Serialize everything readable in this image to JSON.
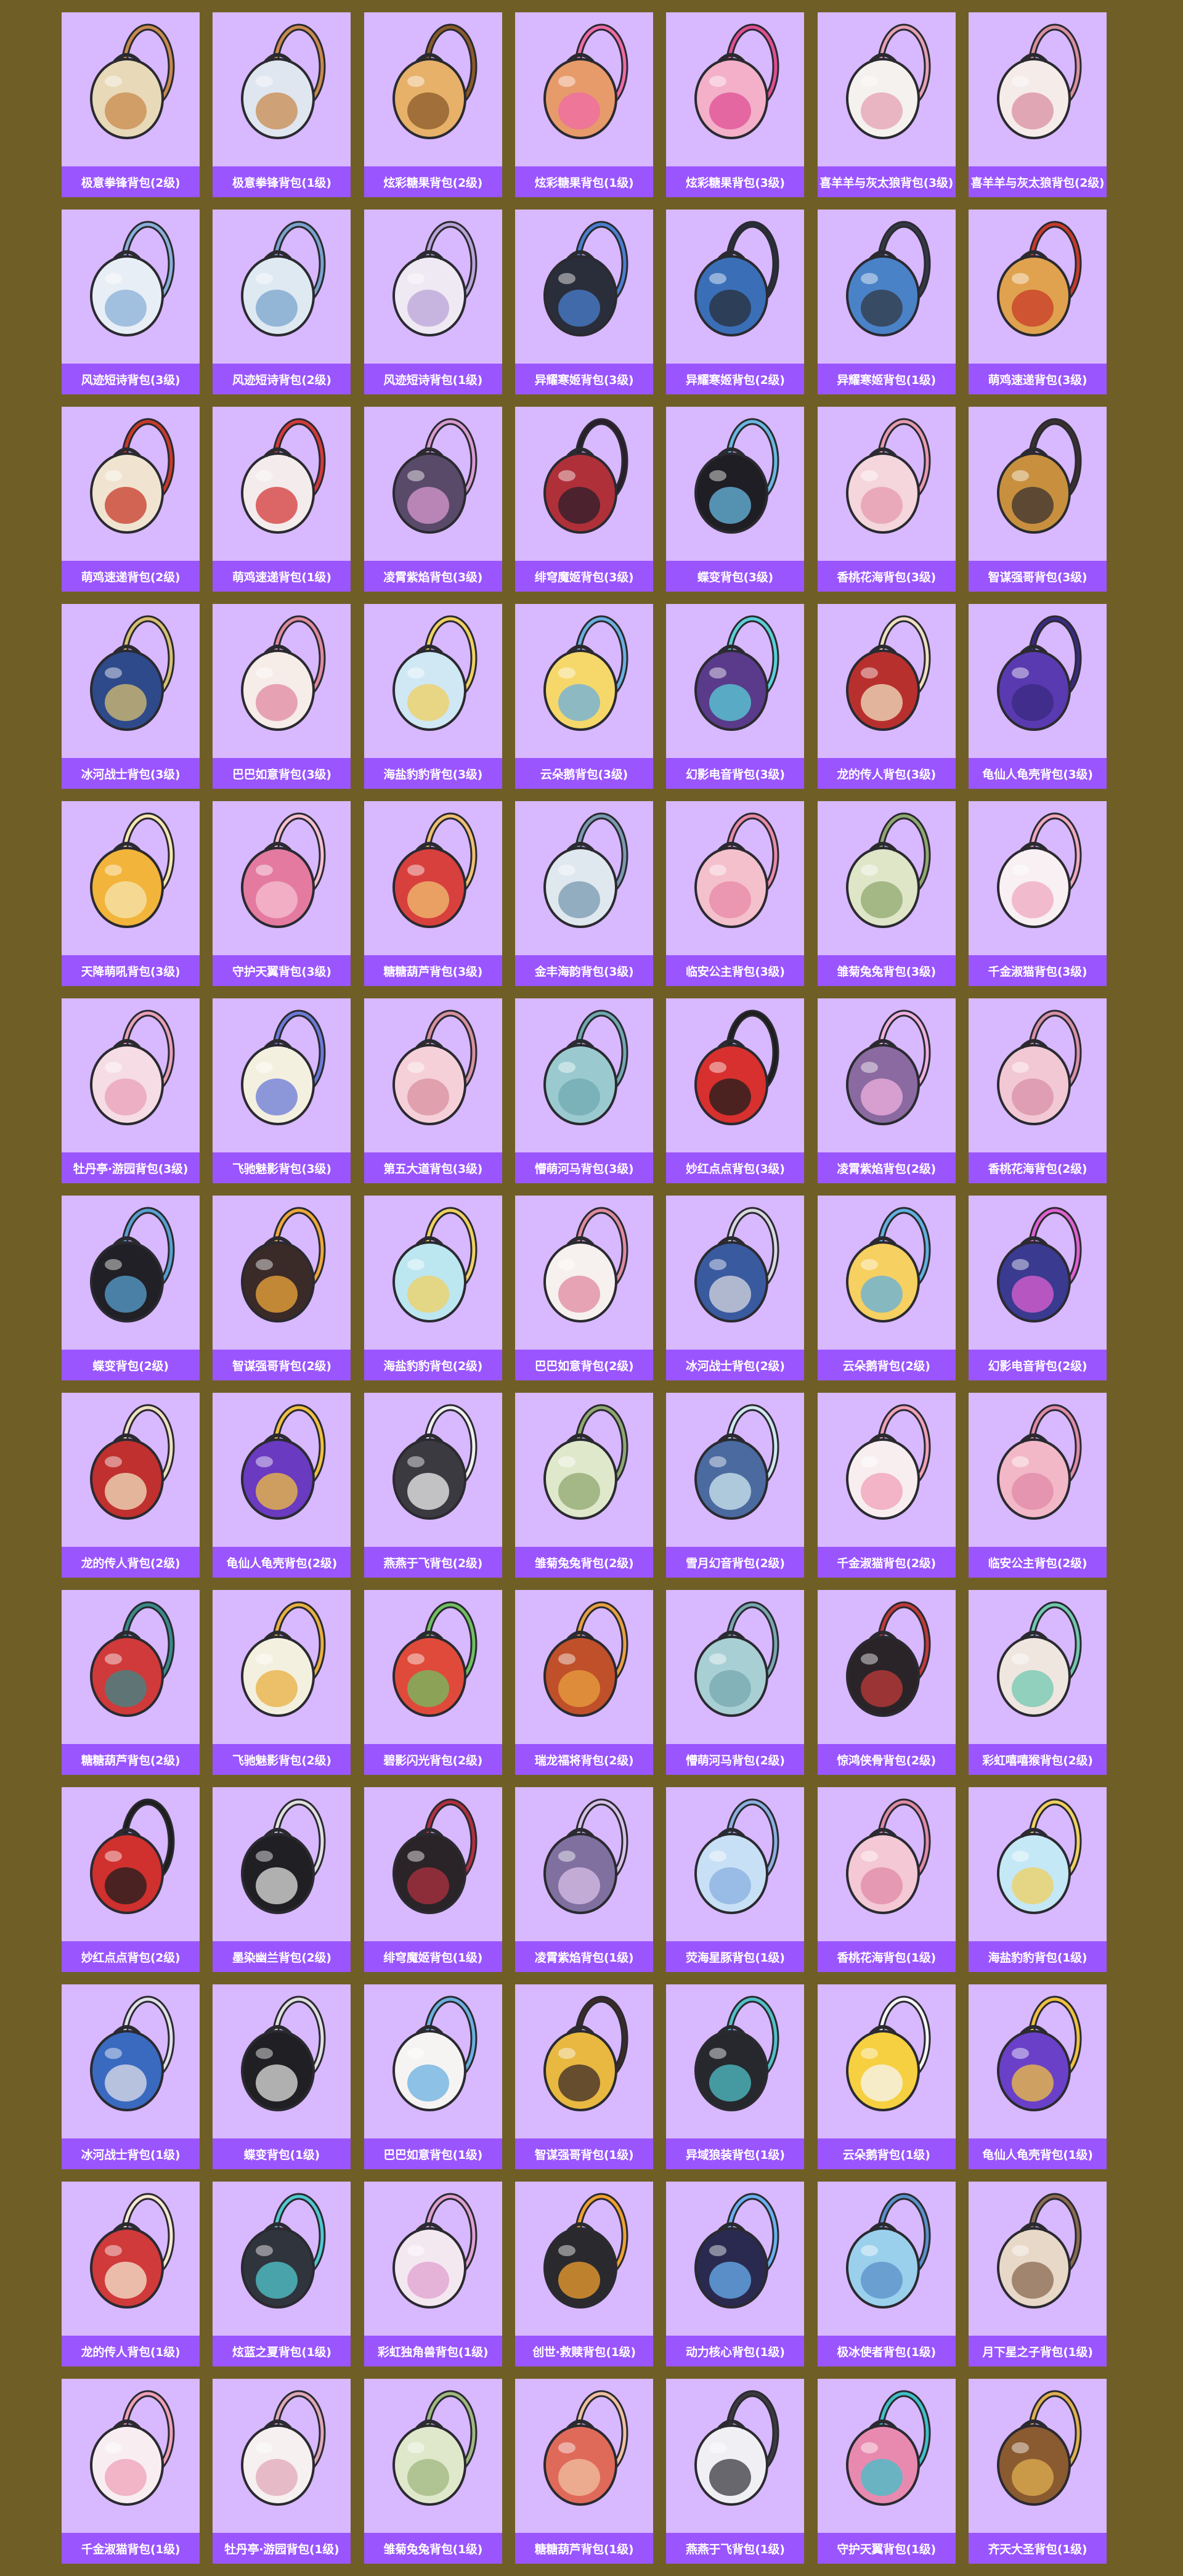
{
  "items": [
    {
      "label": "极意拳锋背包(2级)",
      "icon": "milk-tea-backpack-icon",
      "color": "#e8d9b8",
      "accent": "#c98a4e"
    },
    {
      "label": "极意拳锋背包(1级)",
      "icon": "milk-tea-backpack-icon",
      "color": "#dfe6f0",
      "accent": "#c98a4e"
    },
    {
      "label": "炫彩糖果背包(2级)",
      "icon": "donut-backpack-icon",
      "color": "#e7b16a",
      "accent": "#8a5a2a"
    },
    {
      "label": "炫彩糖果背包(1级)",
      "icon": "donut-backpack-icon",
      "color": "#e79a6a",
      "accent": "#f06aa8"
    },
    {
      "label": "炫彩糖果背包(3级)",
      "icon": "donut-backpack-icon",
      "color": "#f3b0c8",
      "accent": "#e04f94"
    },
    {
      "label": "喜羊羊与灰太狼背包(3级)",
      "icon": "sheep-backpack-icon",
      "color": "#f4f1ee",
      "accent": "#e6a0b4"
    },
    {
      "label": "喜羊羊与灰太狼背包(2级)",
      "icon": "sheep-backpack-icon",
      "color": "#f5ecea",
      "accent": "#d98fa0"
    },
    {
      "label": "风迹短诗背包(3级)",
      "icon": "poem-backpack-icon",
      "color": "#e8eef5",
      "accent": "#8ab0d8"
    },
    {
      "label": "风迹短诗背包(2级)",
      "icon": "poem-backpack-icon",
      "color": "#dfe9f2",
      "accent": "#7aa3cc"
    },
    {
      "label": "风迹短诗背包(1级)",
      "icon": "poem-backpack-icon",
      "color": "#efe9f3",
      "accent": "#b9a3d8"
    },
    {
      "label": "异耀寒姬背包(3级)",
      "icon": "robot-backpack-icon",
      "color": "#2a2e3a",
      "accent": "#4a7fd0"
    },
    {
      "label": "异耀寒姬背包(2级)",
      "icon": "robot-backpack-icon",
      "color": "#3a6fb8",
      "accent": "#2a2e3a"
    },
    {
      "label": "异耀寒姬背包(1级)",
      "icon": "robot-backpack-icon",
      "color": "#4a82c8",
      "accent": "#333844"
    },
    {
      "label": "萌鸡速递背包(3级)",
      "icon": "chick-backpack-icon",
      "color": "#e0a24e",
      "accent": "#c83a2a"
    },
    {
      "label": "萌鸡速递背包(2级)",
      "icon": "chick-backpack-icon",
      "color": "#f0e4d0",
      "accent": "#c83a2a"
    },
    {
      "label": "萌鸡速递背包(1级)",
      "icon": "chick-backpack-icon",
      "color": "#f4ecec",
      "accent": "#d43a3a"
    },
    {
      "label": "凌霄紫焰背包(3级)",
      "icon": "orb-backpack-icon",
      "color": "#5a4a6a",
      "accent": "#d89ad0"
    },
    {
      "label": "绯穹魔姬背包(3级)",
      "icon": "bat-backpack-icon",
      "color": "#b0303a",
      "accent": "#2a1e2a"
    },
    {
      "label": "蝶变背包(3级)",
      "icon": "butterfly-backpack-icon",
      "color": "#1e1e24",
      "accent": "#68b8e0"
    },
    {
      "label": "香桃花海背包(3级)",
      "icon": "flower-backpack-icon",
      "color": "#f4d6dc",
      "accent": "#e79ab0"
    },
    {
      "label": "智谋强哥背包(3级)",
      "icon": "bear-backpack-icon",
      "color": "#c8903e",
      "accent": "#3a3030"
    },
    {
      "label": "冰河战士背包(3级)",
      "icon": "school-backpack-icon",
      "color": "#2e4a8a",
      "accent": "#d8c070"
    },
    {
      "label": "巴巴如意背包(3级)",
      "icon": "fox-backpack-icon",
      "color": "#f6ece8",
      "accent": "#e08aa0"
    },
    {
      "label": "海盐豹豹背包(3级)",
      "icon": "seal-backpack-icon",
      "color": "#cfe8f4",
      "accent": "#f0d060"
    },
    {
      "label": "云朵鹅背包(3级)",
      "icon": "cloud-backpack-icon",
      "color": "#f6d86a",
      "accent": "#6ab0e0"
    },
    {
      "label": "幻影电音背包(3级)",
      "icon": "speaker-backpack-icon",
      "color": "#5a3a8a",
      "accent": "#5ad0d8"
    },
    {
      "label": "龙的传人背包(3级)",
      "icon": "school-backpack-icon",
      "color": "#b8302e",
      "accent": "#f0e0c0"
    },
    {
      "label": "龟仙人龟壳背包(3级)",
      "icon": "shell-backpack-icon",
      "color": "#5a3ab0",
      "accent": "#3a2a80"
    },
    {
      "label": "天降萌吼背包(3级)",
      "icon": "school-backpack-icon",
      "color": "#f2b43a",
      "accent": "#f6e6b0"
    },
    {
      "label": "守护天翼背包(3级)",
      "icon": "bird-backpack-icon",
      "color": "#e47aa0",
      "accent": "#f6c0d0"
    },
    {
      "label": "糖糖葫芦背包(3级)",
      "icon": "lantern-backpack-icon",
      "color": "#d8403e",
      "accent": "#f0c070"
    },
    {
      "label": "金丰海韵背包(3级)",
      "icon": "shell-ornament-backpack-icon",
      "color": "#dfe8ee",
      "accent": "#7a9ab0"
    },
    {
      "label": "临安公主背包(3级)",
      "icon": "flower-backpack-icon",
      "color": "#f4c0cc",
      "accent": "#e88aa8"
    },
    {
      "label": "雏菊兔兔背包(3级)",
      "icon": "bunny-backpack-icon",
      "color": "#dfe6c8",
      "accent": "#90a870"
    },
    {
      "label": "千金淑猫背包(3级)",
      "icon": "cat-backpack-icon",
      "color": "#f8f0f2",
      "accent": "#f0a8c0"
    },
    {
      "label": "牡丹亭·游园背包(3级)",
      "icon": "bag-backpack-icon",
      "color": "#f6dce4",
      "accent": "#e8a0b8"
    },
    {
      "label": "飞驰魅影背包(3级)",
      "icon": "wing-backpack-icon",
      "color": "#f4f0e0",
      "accent": "#6a7ad8"
    },
    {
      "label": "第五大道背包(3级)",
      "icon": "quilted-bag-icon",
      "color": "#f6d0d8",
      "accent": "#d890a0"
    },
    {
      "label": "懵萌河马背包(3级)",
      "icon": "hippo-backpack-icon",
      "color": "#9acad0",
      "accent": "#70a8b0"
    },
    {
      "label": "妙红点点背包(3级)",
      "icon": "ladybug-backpack-icon",
      "color": "#d8302e",
      "accent": "#1e1e1e"
    },
    {
      "label": "凌霄紫焰背包(2级)",
      "icon": "orb-backpack-icon",
      "color": "#8a6aa0",
      "accent": "#f0b0e0"
    },
    {
      "label": "香桃花海背包(2级)",
      "icon": "flower-backpack-icon",
      "color": "#f2c8d4",
      "accent": "#d890a8"
    },
    {
      "label": "蝶变背包(2级)",
      "icon": "butterfly-backpack-icon",
      "color": "#202026",
      "accent": "#58a0d0"
    },
    {
      "label": "智谋强哥背包(2级)",
      "icon": "bear-backpack-icon",
      "color": "#3a2a28",
      "accent": "#f0a83a"
    },
    {
      "label": "海盐豹豹背包(2级)",
      "icon": "seal-backpack-icon",
      "color": "#bce6f0",
      "accent": "#f0d060"
    },
    {
      "label": "巴巴如意背包(2级)",
      "icon": "fox-backpack-icon",
      "color": "#f6f0ee",
      "accent": "#e08aa0"
    },
    {
      "label": "冰河战士背包(2级)",
      "icon": "school-backpack-icon",
      "color": "#3a5aa0",
      "accent": "#d8d8e0"
    },
    {
      "label": "云朵鹅背包(2级)",
      "icon": "cloud-backpack-icon",
      "color": "#f6d060",
      "accent": "#60b0e0"
    },
    {
      "label": "幻影电音背包(2级)",
      "icon": "speaker-backpack-icon",
      "color": "#3a3a90",
      "accent": "#e060d0"
    },
    {
      "label": "龙的传人背包(2级)",
      "icon": "school-backpack-icon",
      "color": "#c0302e",
      "accent": "#f0e0c0"
    },
    {
      "label": "龟仙人龟壳背包(2级)",
      "icon": "shell-backpack-icon",
      "color": "#6a3ac0",
      "accent": "#f0c040"
    },
    {
      "label": "燕燕于飞背包(2级)",
      "icon": "swallow-backpack-icon",
      "color": "#3a3a40",
      "accent": "#f0f0f0"
    },
    {
      "label": "雏菊兔兔背包(2级)",
      "icon": "bunny-backpack-icon",
      "color": "#e0e8cc",
      "accent": "#90a870"
    },
    {
      "label": "雪月幻音背包(2级)",
      "icon": "speaker-backpack-icon",
      "color": "#4a6aa0",
      "accent": "#d0e8f0"
    },
    {
      "label": "千金淑猫背包(2级)",
      "icon": "cat-backpack-icon",
      "color": "#f8eef0",
      "accent": "#f0a0b8"
    },
    {
      "label": "临安公主背包(2级)",
      "icon": "flower-backpack-icon",
      "color": "#f2b8c8",
      "accent": "#e08aa8"
    },
    {
      "label": "糖糖葫芦背包(2级)",
      "icon": "lantern-backpack-icon",
      "color": "#d03a3a",
      "accent": "#3a8a8a"
    },
    {
      "label": "飞驰魅影背包(2级)",
      "icon": "wing-backpack-icon",
      "color": "#f4f0e0",
      "accent": "#e8b040"
    },
    {
      "label": "碧影闪光背包(2级)",
      "icon": "gamepad-backpack-icon",
      "color": "#e04a3a",
      "accent": "#70c060"
    },
    {
      "label": "瑞龙福将背包(2级)",
      "icon": "dragon-backpack-icon",
      "color": "#c0502a",
      "accent": "#e8a040"
    },
    {
      "label": "懵萌河马背包(2级)",
      "icon": "hippo-backpack-icon",
      "color": "#a8d0d4",
      "accent": "#78a8b0"
    },
    {
      "label": "惊鸿侠骨背包(2级)",
      "icon": "armor-backpack-icon",
      "color": "#2a2428",
      "accent": "#c03a3a"
    },
    {
      "label": "彩虹嘻嘻猴背包(2级)",
      "icon": "rainbow-backpack-icon",
      "color": "#f0e6e0",
      "accent": "#70c8b0"
    },
    {
      "label": "妙红点点背包(2级)",
      "icon": "ladybug-backpack-icon",
      "color": "#d0302e",
      "accent": "#1e1e1e"
    },
    {
      "label": "墨染幽兰背包(2级)",
      "icon": "drum-backpack-icon",
      "color": "#202024",
      "accent": "#e0e0e0"
    },
    {
      "label": "绯穹魔姬背包(1级)",
      "icon": "bat-backpack-icon",
      "color": "#2a2428",
      "accent": "#b03040"
    },
    {
      "label": "凌霄紫焰背包(1级)",
      "icon": "orb-backpack-icon",
      "color": "#8070a0",
      "accent": "#d8c0e8"
    },
    {
      "label": "荧海星豚背包(1级)",
      "icon": "dolphin-backpack-icon",
      "color": "#c8e0f6",
      "accent": "#8ab0e0"
    },
    {
      "label": "香桃花海背包(1级)",
      "icon": "flower-backpack-icon",
      "color": "#f4c8d4",
      "accent": "#e08aa8"
    },
    {
      "label": "海盐豹豹背包(1级)",
      "icon": "seal-backpack-icon",
      "color": "#c4e8f6",
      "accent": "#f0d060"
    },
    {
      "label": "冰河战士背包(1级)",
      "icon": "school-backpack-icon",
      "color": "#3a6ac0",
      "accent": "#e0e0e8"
    },
    {
      "label": "蝶变背包(1级)",
      "icon": "butterfly-backpack-icon",
      "color": "#202024",
      "accent": "#e0e0e0"
    },
    {
      "label": "巴巴如意背包(1级)",
      "icon": "egg-backpack-icon",
      "color": "#f6f4f2",
      "accent": "#6ab0e0"
    },
    {
      "label": "智谋强哥背包(1级)",
      "icon": "bear-backpack-icon",
      "color": "#e8b840",
      "accent": "#3a2a28"
    },
    {
      "label": "异域狼装背包(1级)",
      "icon": "tech-backpack-icon",
      "color": "#26282e",
      "accent": "#50c0c8"
    },
    {
      "label": "云朵鹅背包(1级)",
      "icon": "cloud-backpack-icon",
      "color": "#f6d040",
      "accent": "#f6f6f6"
    },
    {
      "label": "龟仙人龟壳背包(1级)",
      "icon": "shell-backpack-icon",
      "color": "#6a40c8",
      "accent": "#f0c040"
    },
    {
      "label": "龙的传人背包(1级)",
      "icon": "school-backpack-icon",
      "color": "#d03a3a",
      "accent": "#f6e8d0"
    },
    {
      "label": "炫蓝之夏背包(1级)",
      "icon": "tech-backpack-icon",
      "color": "#30343c",
      "accent": "#50c8d0"
    },
    {
      "label": "彩虹独角兽背包(1级)",
      "icon": "unicorn-backpack-icon",
      "color": "#f4e8f0",
      "accent": "#e0a0d0"
    },
    {
      "label": "创世·救赎背包(1级)",
      "icon": "armor-backpack-icon",
      "color": "#2a2a2e",
      "accent": "#f0a030"
    },
    {
      "label": "动力核心背包(1级)",
      "icon": "tech-backpack-icon",
      "color": "#2a2a50",
      "accent": "#6ab0f0"
    },
    {
      "label": "极冰使者背包(1级)",
      "icon": "crystal-backpack-icon",
      "color": "#9ad0ec",
      "accent": "#5a90c8"
    },
    {
      "label": "月下星之子背包(1级)",
      "icon": "orb-backpack-icon",
      "color": "#e8d8c8",
      "accent": "#8a6a50"
    },
    {
      "label": "千金淑猫背包(1级)",
      "icon": "cat-backpack-icon",
      "color": "#f8eef2",
      "accent": "#f0a0b8"
    },
    {
      "label": "牡丹亭·游园背包(1级)",
      "icon": "bag-backpack-icon",
      "color": "#f6f0f0",
      "accent": "#e0a8b8"
    },
    {
      "label": "雏菊兔兔背包(1级)",
      "icon": "bunny-backpack-icon",
      "color": "#e0e8cc",
      "accent": "#a0b880"
    },
    {
      "label": "糖糖葫芦背包(1级)",
      "icon": "lantern-backpack-icon",
      "color": "#e06a5a",
      "accent": "#f0c0a0"
    },
    {
      "label": "燕燕于飞背包(1级)",
      "icon": "swallow-backpack-icon",
      "color": "#f0f0f4",
      "accent": "#3a3a40"
    },
    {
      "label": "守护天翼背包(1级)",
      "icon": "bird-backpack-icon",
      "color": "#e88ab0",
      "accent": "#40c0c8"
    },
    {
      "label": "齐天大圣背包(1级)",
      "icon": "monkey-king-backpack-icon",
      "color": "#8a5a30",
      "accent": "#e0b050"
    }
  ]
}
